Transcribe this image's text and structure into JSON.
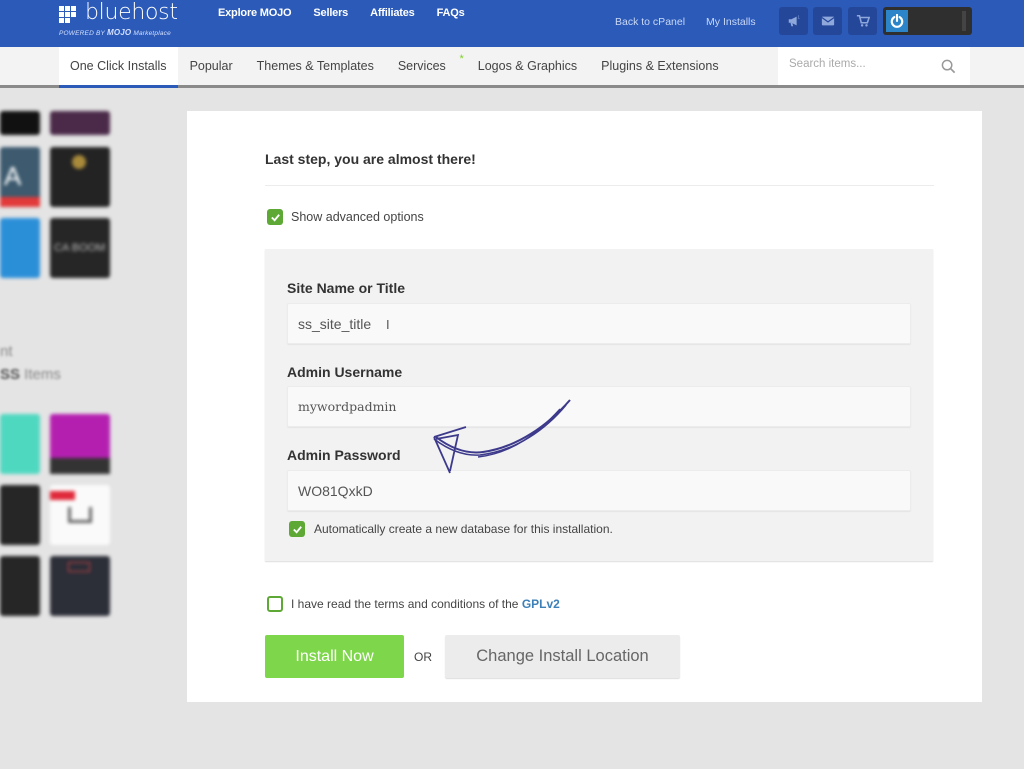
{
  "brand": {
    "name": "bluehost",
    "powered_prefix": "POWERED BY",
    "powered_brand": "MOJO",
    "powered_suffix": "Marketplace"
  },
  "topnav": [
    "Explore MOJO",
    "Sellers",
    "Affiliates",
    "FAQs"
  ],
  "toplinks": [
    "Back to cPanel",
    "My Installs"
  ],
  "top_icons": [
    {
      "name": "megaphone-icon",
      "badge": "1"
    },
    {
      "name": "mail-icon"
    },
    {
      "name": "cart-icon"
    }
  ],
  "tabs": [
    {
      "label": "One Click Installs",
      "active": true
    },
    {
      "label": "Popular"
    },
    {
      "label": "Themes & Templates"
    },
    {
      "label": "Services",
      "star": "*"
    },
    {
      "label": "Logos & Graphics"
    },
    {
      "label": "Plugins & Extensions"
    }
  ],
  "search": {
    "placeholder": "Search items..."
  },
  "sidebar": {
    "text_line1": "nt",
    "text_line2_bold": "SS",
    "text_line2_rest": " Items"
  },
  "form": {
    "heading": "Last step, you are almost there!",
    "show_advanced": {
      "label": "Show advanced options",
      "checked": true
    },
    "site_name": {
      "label": "Site Name or Title",
      "value": "ss_site_title"
    },
    "admin_username": {
      "label": "Admin Username",
      "value": "mywordpadmin"
    },
    "admin_password": {
      "label": "Admin Password",
      "value": "WO81QxkD"
    },
    "auto_db": {
      "label": "Automatically create a new database for this installation.",
      "checked": true
    },
    "terms": {
      "label": "I have read the terms and conditions of the",
      "link": "GPLv2",
      "checked": false
    },
    "install_button": "Install Now",
    "or": "OR",
    "change_location_button": "Change Install Location"
  },
  "colors": {
    "brand_blue": "#2b5ab8",
    "install_green": "#7ed64a",
    "checkbox_green": "#5ea936",
    "annotation_arrow": "#3d3a8c"
  }
}
